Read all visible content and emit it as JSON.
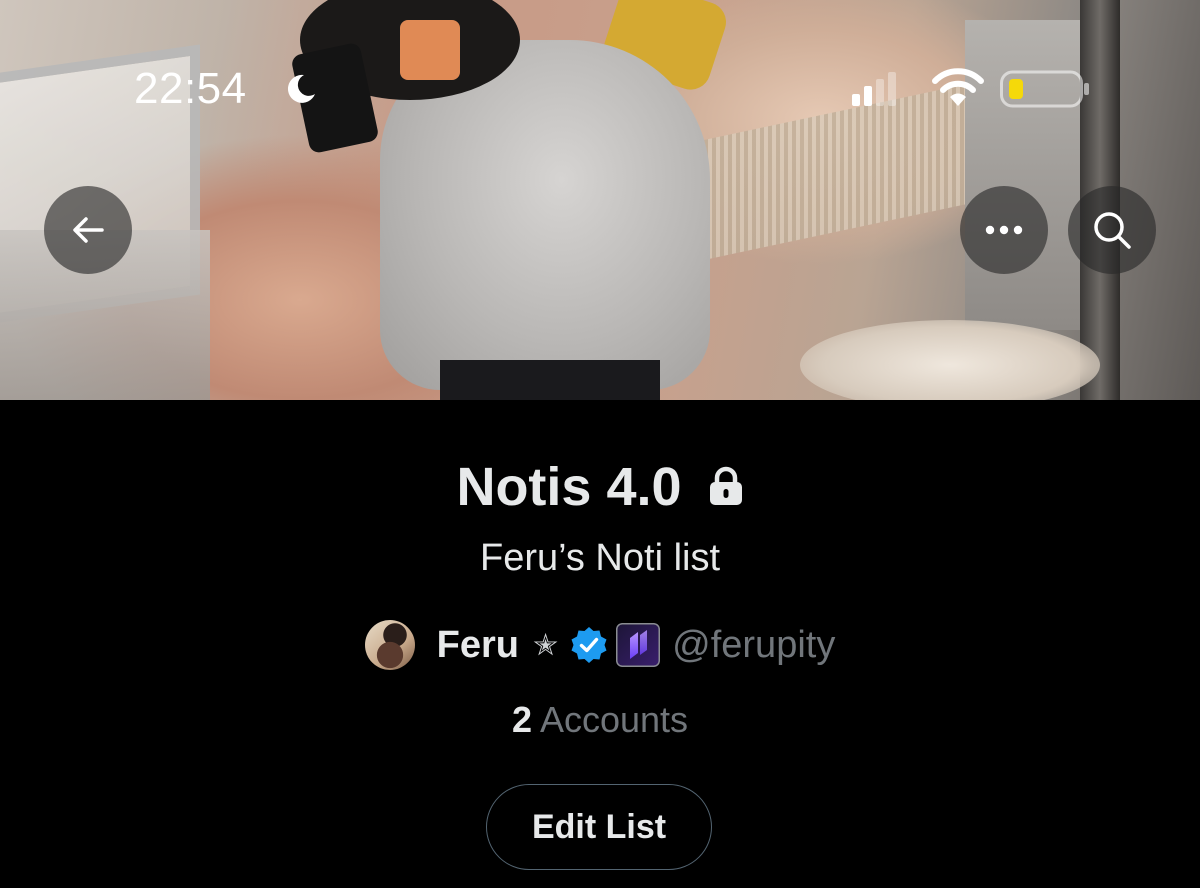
{
  "status_bar": {
    "time": "22:54"
  },
  "icons": {
    "back": "back-arrow-icon",
    "more": "more-icon",
    "search": "search-icon",
    "lock": "lock-icon",
    "verified": "verified-badge-icon"
  },
  "list": {
    "name": "Notis 4.0",
    "description": "Feru’s Noti list",
    "accounts_count": "2",
    "accounts_label": "Accounts"
  },
  "owner": {
    "name": "Feru",
    "star": "✭",
    "handle": "@ferupity"
  },
  "actions": {
    "edit_label": "Edit List"
  },
  "colors": {
    "background": "#000000",
    "primary_text": "#e7e9ea",
    "secondary_text": "#71767b",
    "verified_blue": "#1d9bf0",
    "button_border": "#536471"
  }
}
